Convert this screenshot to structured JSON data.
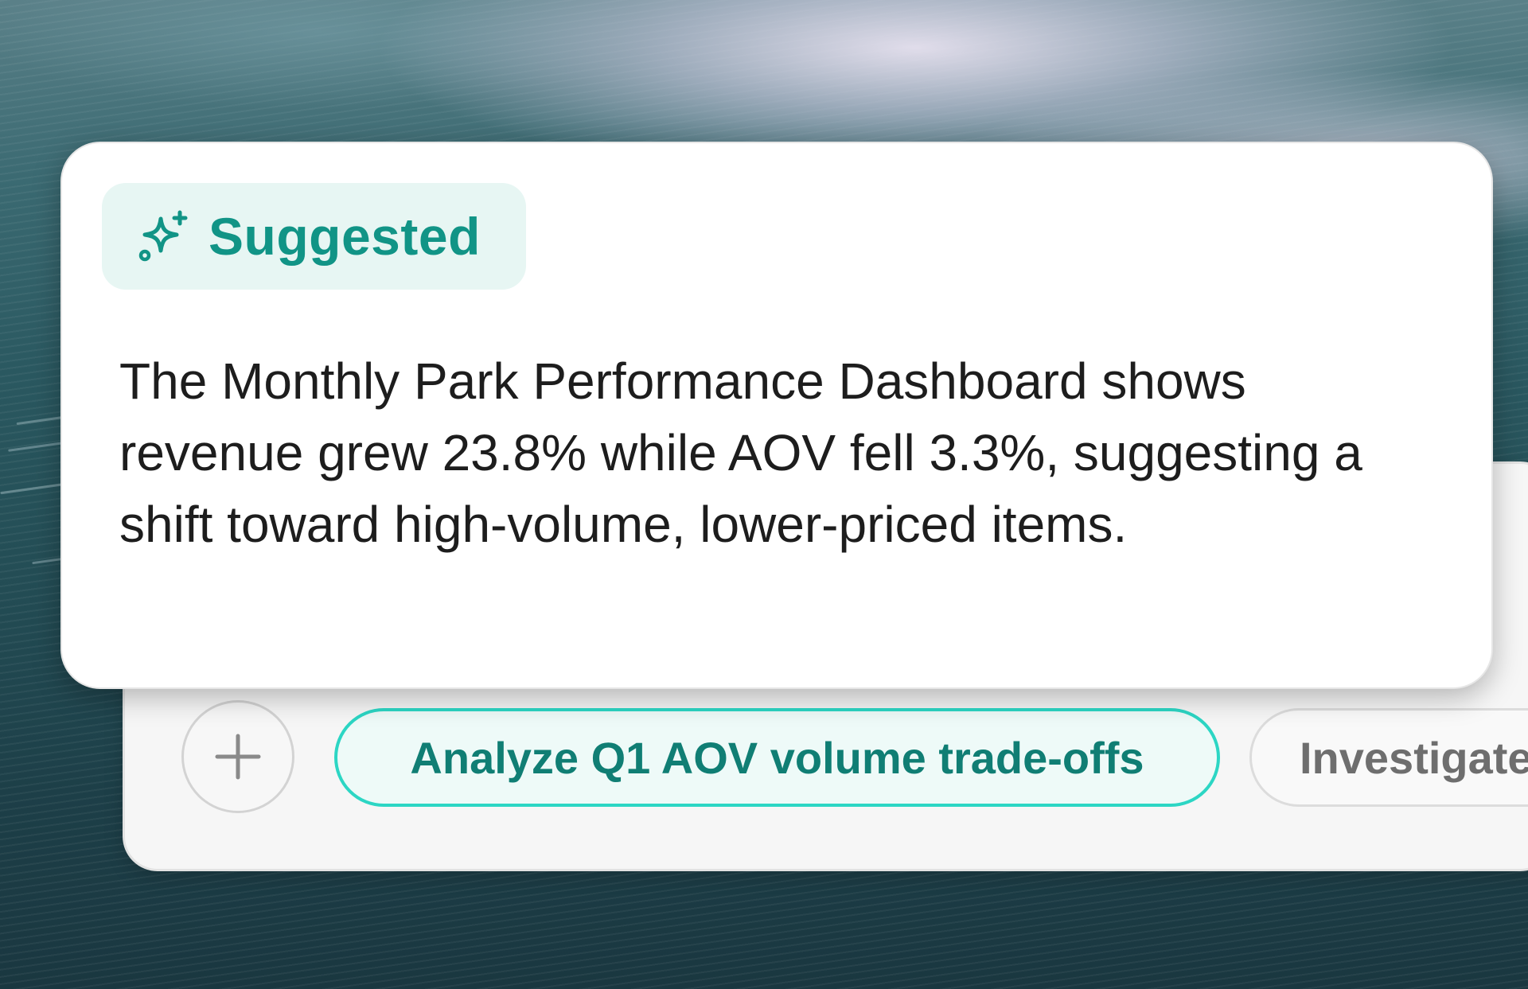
{
  "card": {
    "badge_label": "Suggested",
    "badge_icon": "sparkles-icon",
    "body_text": "The Monthly Park Performance Dashboard shows revenue grew 23.8% while AOV fell 3.3%, suggesting a shift toward high-volume, lower-priced items."
  },
  "input_bar": {
    "plus_icon": "plus-icon",
    "chips": [
      {
        "label": "Analyze Q1 AOV volume trade-offs"
      },
      {
        "label": "Investigate"
      }
    ]
  },
  "colors": {
    "accent": "#119486",
    "chip_border": "#2cd6c4",
    "badge_bg": "#e7f6f3"
  }
}
